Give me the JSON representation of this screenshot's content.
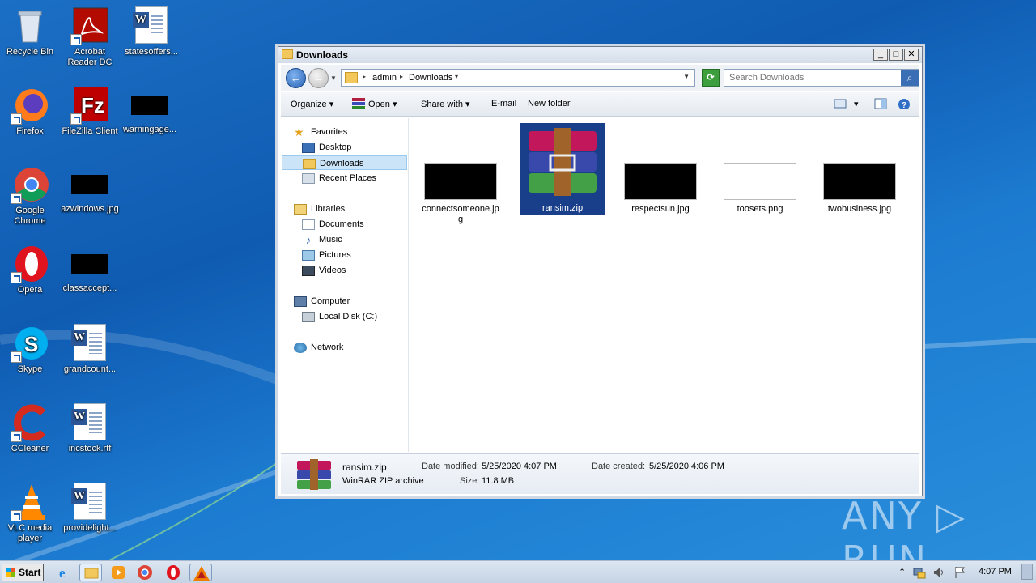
{
  "desktop": {
    "icons": [
      {
        "label": "Recycle Bin",
        "icon": "recycle-bin-icon"
      },
      {
        "label": "Acrobat Reader DC",
        "icon": "acrobat-icon"
      },
      {
        "label": "statesoffers...",
        "icon": "word-doc-icon"
      },
      {
        "label": "Firefox",
        "icon": "firefox-icon"
      },
      {
        "label": "FileZilla Client",
        "icon": "filezilla-icon"
      },
      {
        "label": "warningage...",
        "icon": "image-file-icon"
      },
      {
        "label": "Google Chrome",
        "icon": "chrome-icon"
      },
      {
        "label": "azwindows.jpg",
        "icon": "image-file-icon"
      },
      {
        "label": "Opera",
        "icon": "opera-icon"
      },
      {
        "label": "classaccept...",
        "icon": "image-file-icon"
      },
      {
        "label": "Skype",
        "icon": "skype-icon"
      },
      {
        "label": "grandcount...",
        "icon": "word-doc-icon"
      },
      {
        "label": "CCleaner",
        "icon": "ccleaner-icon"
      },
      {
        "label": "incstock.rtf",
        "icon": "word-doc-icon"
      },
      {
        "label": "VLC media player",
        "icon": "vlc-icon"
      },
      {
        "label": "providelight...",
        "icon": "word-doc-icon"
      }
    ]
  },
  "window": {
    "title": "Downloads",
    "controls": {
      "minimize": "_",
      "maximize": "□",
      "close": "✕"
    },
    "address": {
      "crumbs": [
        "admin",
        "Downloads"
      ]
    },
    "search": {
      "placeholder": "Search Downloads"
    },
    "toolbar": {
      "organize": "Organize",
      "open": "Open",
      "share_with": "Share with",
      "email": "E-mail",
      "new_folder": "New folder"
    },
    "nav": {
      "favorites": "Favorites",
      "desktop": "Desktop",
      "downloads": "Downloads",
      "recent_places": "Recent Places",
      "libraries": "Libraries",
      "documents": "Documents",
      "music": "Music",
      "pictures": "Pictures",
      "videos": "Videos",
      "computer": "Computer",
      "local_disk": "Local Disk (C:)",
      "network": "Network"
    },
    "files": [
      {
        "name": "connectsomeone.jpg",
        "type": "image",
        "selected": false
      },
      {
        "name": "ransim.zip",
        "type": "zip",
        "selected": true
      },
      {
        "name": "respectsun.jpg",
        "type": "image",
        "selected": false
      },
      {
        "name": "toosets.png",
        "type": "image-light",
        "selected": false
      },
      {
        "name": "twobusiness.jpg",
        "type": "image",
        "selected": false
      }
    ],
    "details": {
      "name": "ransim.zip",
      "type": "WinRAR ZIP archive",
      "date_modified_label": "Date modified:",
      "date_modified": "5/25/2020 4:07 PM",
      "size_label": "Size:",
      "size": "11.8 MB",
      "date_created_label": "Date created:",
      "date_created": "5/25/2020 4:06 PM"
    }
  },
  "taskbar": {
    "start_label": "Start",
    "apps": [
      "ie-icon",
      "explorer-icon",
      "media-player-icon",
      "chrome-icon",
      "opera-icon",
      "avast-icon"
    ],
    "clock": "4:07 PM"
  },
  "watermark": "ANY ▷ RUN"
}
